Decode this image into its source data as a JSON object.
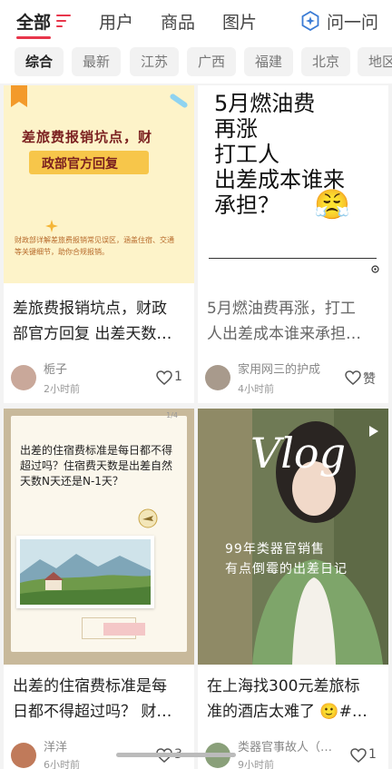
{
  "tabs": [
    {
      "label": "全部",
      "active": true
    },
    {
      "label": "用户"
    },
    {
      "label": "商品"
    },
    {
      "label": "图片"
    }
  ],
  "ask": {
    "label": "问一问",
    "icon": "sparkle-hexagon-icon"
  },
  "chips": [
    "综合",
    "最新",
    "江苏",
    "广西",
    "福建",
    "北京",
    "地区"
  ],
  "accent": "#e8364b",
  "cards": [
    {
      "cover": {
        "headline1": "差旅费报销坑点，财",
        "headline2": "政部官方回复",
        "body": "财政部详解差旅费报销常见误区，涵盖住宿、交通等关键细节，助你合规报销。"
      },
      "title_line1": "差旅费报销坑点，财政",
      "title_line2": "部官方回复 出差天数…",
      "author": "栀子",
      "time": "2小时前",
      "likes": "1"
    },
    {
      "cover": {
        "lines": [
          "5月燃油费",
          "再涨",
          "打工人",
          "出差成本谁来",
          "承担？"
        ],
        "emoji": "😤"
      },
      "title_line1": "5月燃油费再涨，打工",
      "title_line2": "人出差成本谁来承担…",
      "author": "家用网三的护成",
      "time": "4小时前",
      "likes": "赞"
    },
    {
      "cover": {
        "page": "1/4",
        "text": "出差的住宿费标准是每日都不得超过吗？住宿费天数是出差自然天数N天还是N-1天？"
      },
      "title_line1": "出差的住宿费标准是每",
      "title_line2": "日都不得超过吗？ 财…",
      "author": "洋洋",
      "time": "6小时前",
      "likes": "3"
    },
    {
      "cover": {
        "vlog": "Vlog",
        "caption1": "99年类器官销售",
        "caption2": "有点倒霉的出差日记"
      },
      "title_line1": "在上海找300元差旅标",
      "title_line2": "准的酒店太难了 🙂#…",
      "author": "类器官事故人（…",
      "time": "9小时前",
      "likes": "1"
    }
  ]
}
